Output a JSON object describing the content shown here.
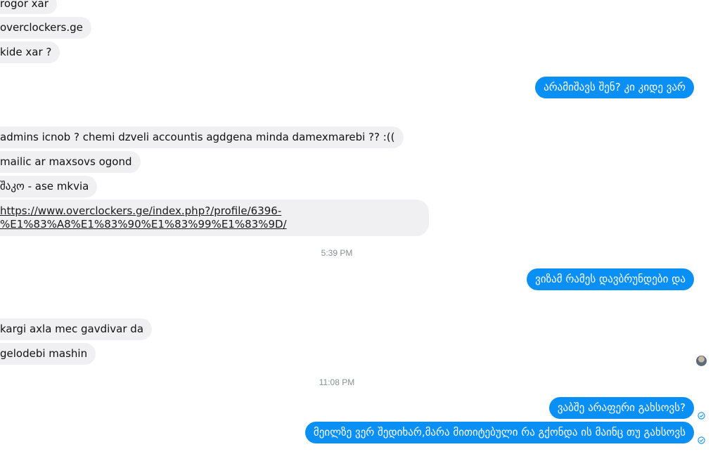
{
  "conversation": {
    "messages": [
      {
        "text": "rogor xar"
      },
      {
        "text": "overclockers.ge"
      },
      {
        "text": "kide xar ?"
      },
      {
        "text": "არამიშავს შენ? კი კიდე ვარ"
      },
      {
        "text": "admins icnob ? chemi dzveli accountis agdgena minda damexmarebi ?? :(("
      },
      {
        "text": "mailic ar maxsovs ogond"
      },
      {
        "text": "შაკო - ase mkvia"
      },
      {
        "link_line1": "https://www.overclockers.ge/index.php?/profile/6396-",
        "link_line2": "%E1%83%A8%E1%83%90%E1%83%99%E1%83%9D/"
      },
      {
        "text": "ვიზამ რამეს დავბრუნდები და"
      },
      {
        "text": "kargi axla mec gavdivar da"
      },
      {
        "text": "gelodebi mashin"
      },
      {
        "text": "ვაბშე არაფერი გახსოვს?"
      },
      {
        "text": "მეილზე ვერ შედიხარ,მარა მითიტებული რა გქონდა ის მაინც თუ გახსოვს"
      }
    ],
    "timestamps": [
      "5:39 PM",
      "11:08 PM"
    ]
  },
  "colors": {
    "outgoing_bubble": "#0a8ff5",
    "incoming_bubble": "#f0eff1",
    "timestamp": "#8a8d91",
    "read_receipt": "#0a8ff5"
  },
  "icons": {
    "read_receipt": "check-circle-icon",
    "seen_avatar": "avatar"
  }
}
